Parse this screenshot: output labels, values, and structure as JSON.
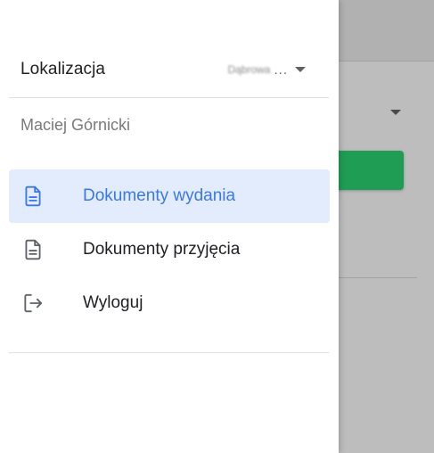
{
  "drawer": {
    "location_label": "Lokalizacja",
    "location_value": "Dąbrowa",
    "location_ellipsis": "...",
    "user_name": "Maciej Górnicki"
  },
  "menu": {
    "items": [
      {
        "label": "Dokumenty wydania",
        "icon": "document-icon",
        "active": true
      },
      {
        "label": "Dokumenty przyjęcia",
        "icon": "document-icon",
        "active": false
      },
      {
        "label": "Wyloguj",
        "icon": "logout-icon",
        "active": false
      }
    ]
  },
  "colors": {
    "active_text": "#3b78e7",
    "active_background": "#e3ecfd",
    "primary_button": "#1f9d55",
    "overlay": "#bdbdbd"
  }
}
